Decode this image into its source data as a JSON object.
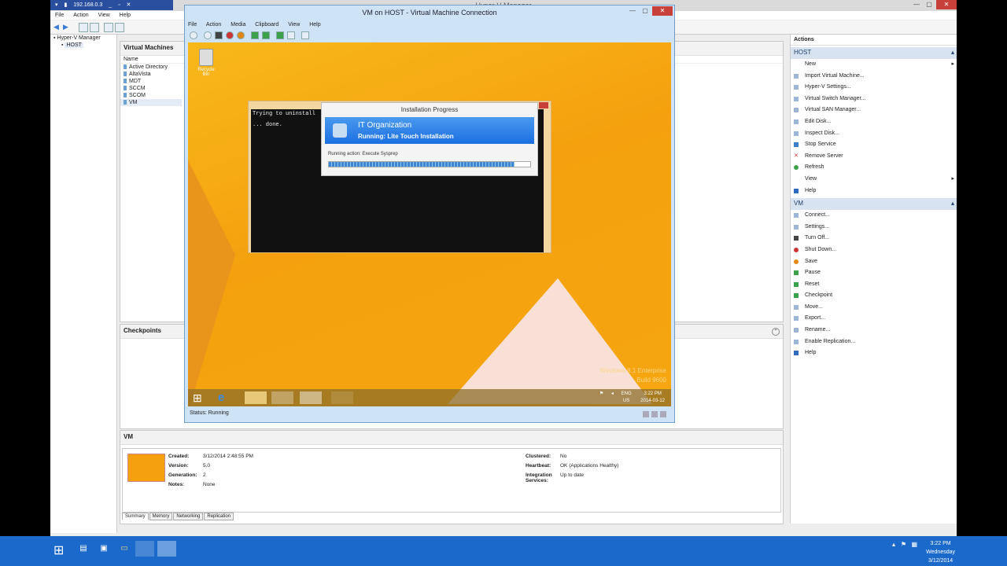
{
  "host": {
    "title": "Hyper-V Manager",
    "rdp_address": "192.168.0.3",
    "menu": [
      "File",
      "Action",
      "View",
      "Help"
    ],
    "tree": [
      "Hyper-V Manager",
      "HOST"
    ]
  },
  "vms_pane": {
    "title": "Virtual Machines",
    "column_name": "Name",
    "rows": [
      "Active Directory",
      "AltaVista",
      "MDT",
      "SCCM",
      "SCOM",
      "VM"
    ]
  },
  "checkpoints_pane": {
    "title": "Checkpoints"
  },
  "details": {
    "title": "VM",
    "created_label": "Created:",
    "created": "3/12/2014 2:48:55 PM",
    "version_label": "Version:",
    "version": "5.0",
    "generation_label": "Generation:",
    "generation": "2",
    "notes_label": "Notes:",
    "notes": "None",
    "clustered_label": "Clustered:",
    "clustered": "No",
    "heartbeat_label": "Heartbeat:",
    "heartbeat": "OK (Applications Healthy)",
    "integration_label": "Integration Services:",
    "integration": "Up to date",
    "tabs": [
      "Summary",
      "Memory",
      "Networking",
      "Replication"
    ]
  },
  "actions": {
    "title": "Actions",
    "host_section": "HOST",
    "host_items": [
      "New",
      "Import Virtual Machine...",
      "Hyper-V Settings...",
      "Virtual Switch Manager...",
      "Virtual SAN Manager...",
      "Edit Disk...",
      "Inspect Disk...",
      "Stop Service",
      "Remove Server",
      "Refresh",
      "View",
      "Help"
    ],
    "vm_section": "VM",
    "vm_items": [
      "Connect...",
      "Settings...",
      "Turn Off...",
      "Shut Down...",
      "Save",
      "Pause",
      "Reset",
      "Checkpoint",
      "Move...",
      "Export...",
      "Rename...",
      "Enable Replication...",
      "Help"
    ]
  },
  "vmc": {
    "title": "VM on HOST - Virtual Machine Connection",
    "menu": [
      "File",
      "Action",
      "Media",
      "Clipboard",
      "View",
      "Help"
    ],
    "status": "Status: Running"
  },
  "guest": {
    "recycle_label": "Recycle Bin",
    "console_line1": "Trying to uninstall",
    "console_line2": "... done.",
    "install_title": "Installation Progress",
    "install_org": "IT Organization",
    "install_status": "Running: Lite Touch Installation",
    "install_action": "Running action: Execute Sysprep",
    "install_progress": 0.92,
    "watermark_line1": "Windows 8.1 Enterprise",
    "watermark_line2": "Build 9600",
    "tray_lang1": "ENG",
    "tray_lang2": "US",
    "tray_time": "3:22 PM",
    "tray_date": "2014-03-12"
  },
  "taskbar": {
    "time": "3:22 PM",
    "day": "Wednesday",
    "date": "3/12/2014"
  },
  "colors": {
    "accent": "#1b6acb",
    "guest_bg": "#f5a10f"
  }
}
